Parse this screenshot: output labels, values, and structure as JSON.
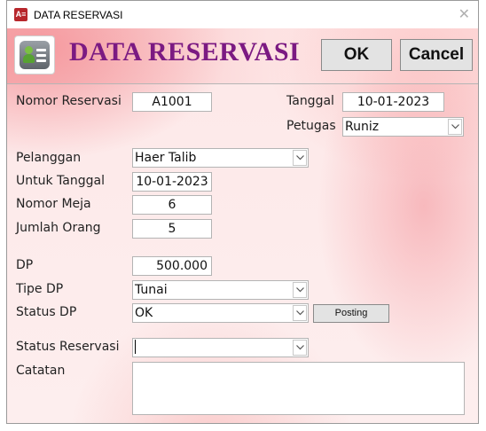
{
  "window": {
    "app_icon": "A≡",
    "title": "DATA RESERVASI",
    "close_glyph": "✕"
  },
  "header": {
    "form_title": "DATA RESERVASI",
    "logo_icon": "contact-card-icon",
    "ok_label": "OK",
    "cancel_label": "Cancel"
  },
  "fields": {
    "nomor_reservasi": {
      "label": "Nomor Reservasi",
      "value": "A1001"
    },
    "tanggal": {
      "label": "Tanggal",
      "value": "10-01-2023"
    },
    "petugas": {
      "label": "Petugas",
      "value": "Runiz"
    },
    "pelanggan": {
      "label": "Pelanggan",
      "value": "Haer Talib"
    },
    "untuk_tanggal": {
      "label": "Untuk Tanggal",
      "value": "10-01-2023"
    },
    "nomor_meja": {
      "label": "Nomor Meja",
      "value": "6"
    },
    "jumlah_orang": {
      "label": "Jumlah Orang",
      "value": "5"
    },
    "dp": {
      "label": "DP",
      "value": "500.000"
    },
    "tipe_dp": {
      "label": "Tipe DP",
      "value": "Tunai"
    },
    "status_dp": {
      "label": "Status DP",
      "value": "OK"
    },
    "posting_label": "Posting",
    "status_reservasi": {
      "label": "Status Reservasi",
      "value": ""
    },
    "catatan": {
      "label": "Catatan",
      "value": ""
    }
  },
  "colors": {
    "title_purple": "#7b1a82",
    "background_pink": "#fde8e8",
    "app_icon_red": "#b7272c"
  }
}
